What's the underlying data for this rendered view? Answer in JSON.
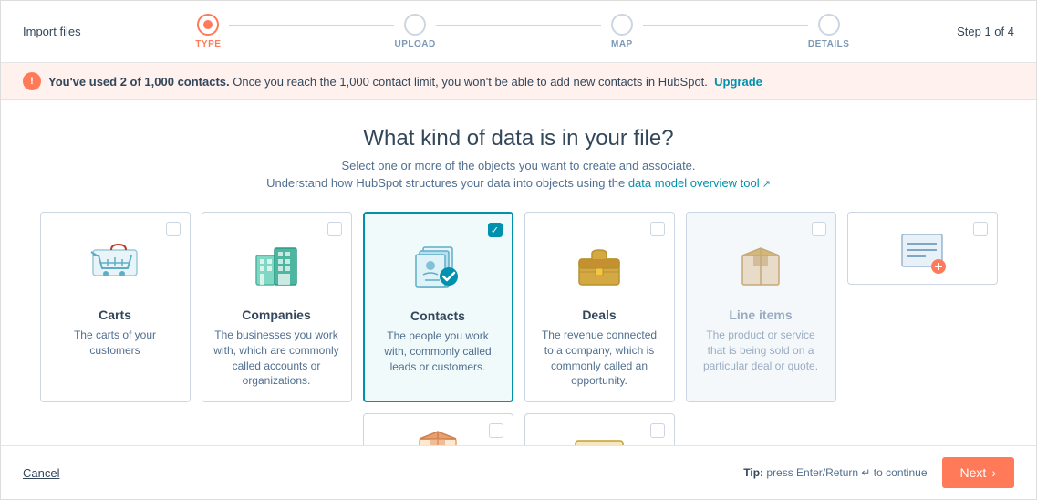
{
  "header": {
    "import_label": "Import files",
    "step_of": "Step 1 of 4",
    "steps": [
      {
        "id": "type",
        "label": "TYPE",
        "active": true
      },
      {
        "id": "upload",
        "label": "UPLOAD",
        "active": false
      },
      {
        "id": "map",
        "label": "MAP",
        "active": false
      },
      {
        "id": "details",
        "label": "DETAILS",
        "active": false
      }
    ]
  },
  "banner": {
    "text_bold": "You've used 2 of 1,000 contacts.",
    "text_rest": " Once you reach the 1,000 contact limit, you won't be able to add new contacts in HubSpot.",
    "upgrade_label": "Upgrade"
  },
  "main": {
    "title": "What kind of data is in your file?",
    "subtitle1": "Select one or more of the objects you want to create and associate.",
    "subtitle2_pre": "Understand how HubSpot structures your data into objects using the",
    "subtitle2_link": "data model overview tool",
    "subtitle2_post": ""
  },
  "cards": [
    {
      "id": "carts",
      "title": "Carts",
      "desc": "The carts of your customers",
      "selected": false,
      "disabled": false
    },
    {
      "id": "companies",
      "title": "Companies",
      "desc": "The businesses you work with, which are commonly called accounts or organizations.",
      "selected": false,
      "disabled": false
    },
    {
      "id": "contacts",
      "title": "Contacts",
      "desc": "The people you work with, commonly called leads or customers.",
      "selected": true,
      "disabled": false
    },
    {
      "id": "deals",
      "title": "Deals",
      "desc": "The revenue connected to a company, which is commonly called an opportunity.",
      "selected": false,
      "disabled": false
    },
    {
      "id": "lineitems",
      "title": "Line items",
      "desc": "The product or service that is being sold on a particular deal or quote.",
      "selected": false,
      "disabled": true
    },
    {
      "id": "row2a",
      "title": "",
      "desc": "",
      "selected": false,
      "disabled": false,
      "partial": true
    },
    {
      "id": "row2b",
      "title": "",
      "desc": "",
      "selected": false,
      "disabled": false,
      "partial": true
    },
    {
      "id": "row2c",
      "title": "",
      "desc": "",
      "selected": false,
      "disabled": false,
      "partial": true
    }
  ],
  "footer": {
    "cancel_label": "Cancel",
    "tip_label": "Tip:",
    "tip_text": " press Enter/Return ↵ to continue",
    "next_label": "Next"
  }
}
